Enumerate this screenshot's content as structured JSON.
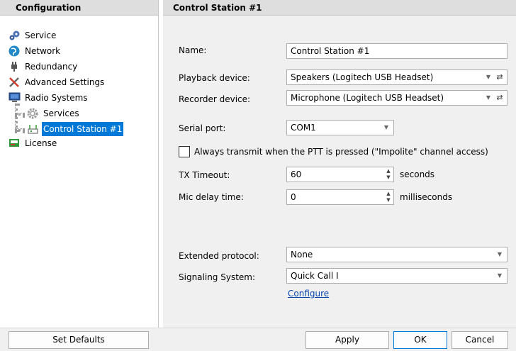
{
  "left_panel": {
    "header": "Configuration",
    "tree": [
      {
        "label": "Service",
        "icon": "gears-icon"
      },
      {
        "label": "Network",
        "icon": "globe-icon"
      },
      {
        "label": "Redundancy",
        "icon": "plug-icon"
      },
      {
        "label": "Advanced Settings",
        "icon": "tools-icon"
      },
      {
        "label": "Radio Systems",
        "icon": "monitor-icon"
      },
      {
        "label": "Services",
        "icon": "gear-icon"
      },
      {
        "label": "Control Station #1",
        "icon": "radio-icon",
        "selected": true
      },
      {
        "label": "License",
        "icon": "license-icon"
      }
    ]
  },
  "right_panel": {
    "header": "Control Station #1",
    "name": {
      "label": "Name:",
      "value": "Control Station #1"
    },
    "playback": {
      "label": "Playback device:",
      "value": "Speakers (Logitech USB Headset)"
    },
    "recorder": {
      "label": "Recorder device:",
      "value": "Microphone (Logitech USB Headset)"
    },
    "serial": {
      "label": "Serial port:",
      "value": "COM1"
    },
    "always_transmit": {
      "label": "Always transmit when the PTT is pressed (\"Impolite\" channel access)",
      "checked": false
    },
    "tx_timeout": {
      "label": "TX Timeout:",
      "value": "60",
      "unit": "seconds"
    },
    "mic_delay": {
      "label": "Mic delay time:",
      "value": "0",
      "unit": "milliseconds"
    },
    "extended_protocol": {
      "label": "Extended protocol:",
      "value": "None"
    },
    "signaling": {
      "label": "Signaling System:",
      "value": "Quick Call I"
    },
    "configure_link": "Configure"
  },
  "buttons": {
    "set_defaults": "Set Defaults",
    "apply": "Apply",
    "ok": "OK",
    "cancel": "Cancel"
  },
  "colors": {
    "selection": "#0078d7",
    "link": "#0645ad",
    "panel_bg": "#f0f0f0",
    "header_bg": "#dedede"
  }
}
